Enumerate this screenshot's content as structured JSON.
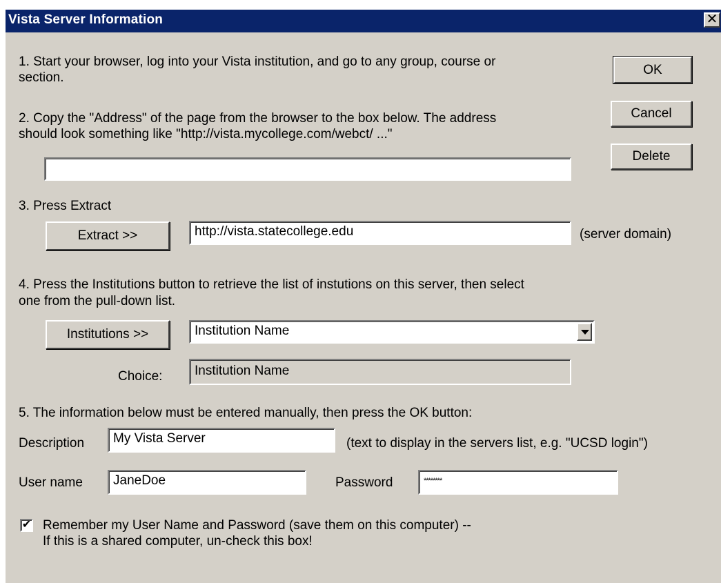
{
  "window": {
    "title": "Vista Server Information",
    "close_glyph": "✕"
  },
  "steps": {
    "step1_line1": "1.  Start your browser, log into your Vista institution, and go to any group, course or",
    "step1_line2": "section.",
    "step2_line1": "2.  Copy the \"Address\" of the page from the browser to the box below.  The address",
    "step2_line2": "should look something like \"http://vista.mycollege.com/webct/ ...\"",
    "step3": "3.  Press Extract",
    "step4_line1": "4.  Press the Institutions button to retrieve the list of instutions on this server, then select",
    "step4_line2": "one from the pull-down list.",
    "step5": "5. The information below must be entered manually, then press the OK button:"
  },
  "buttons": {
    "ok": "OK",
    "cancel": "Cancel",
    "delete": "Delete",
    "extract": "Extract >>",
    "institutions": "Institutions >>"
  },
  "fields": {
    "address_value": "",
    "server_domain_value": "http://vista.statecollege.edu",
    "server_domain_hint": "(server domain)",
    "institution_selected": "Institution Name",
    "choice_label": "Choice:",
    "choice_value": "Institution Name",
    "description_label": "Description",
    "description_value": "My Vista Server",
    "description_hint": "(text to display in the servers list, e.g. \"UCSD login\")",
    "username_label": "User name",
    "username_value": "JaneDoe",
    "password_label": "Password",
    "password_value": "********"
  },
  "remember": {
    "checked": true,
    "check_glyph": "✔",
    "line1": "Remember my User Name and Password (save them on this computer) --",
    "line2": "If this is a shared computer, un-check this box!"
  }
}
